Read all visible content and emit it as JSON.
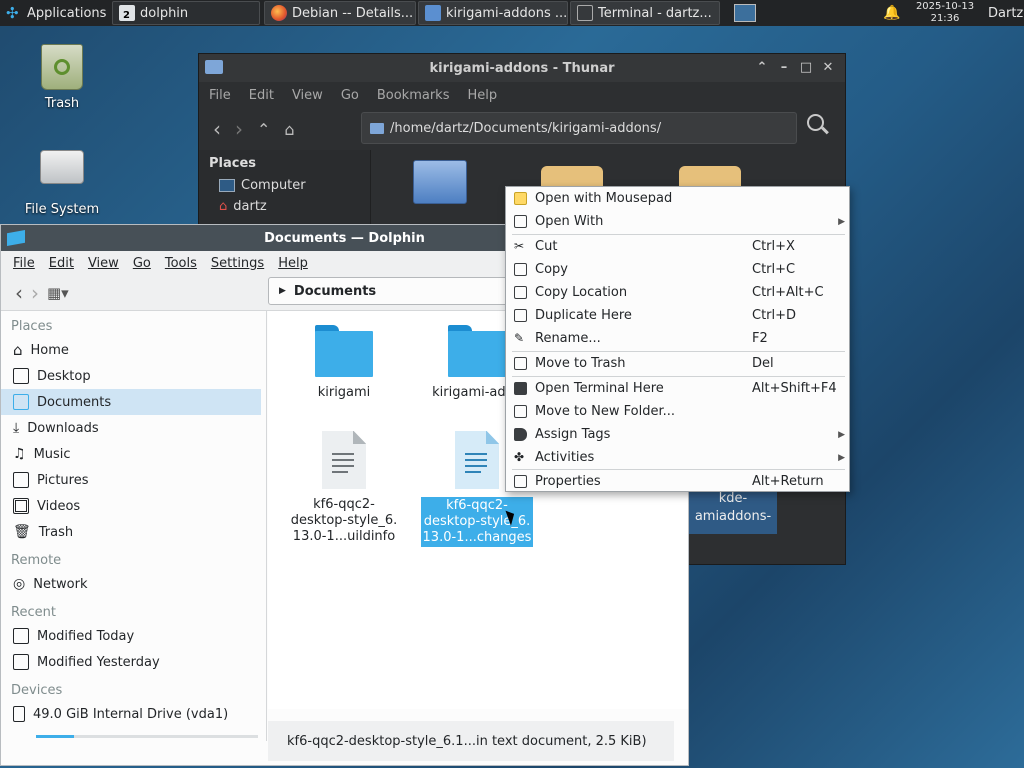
{
  "taskbar": {
    "applications_label": "Applications",
    "workspace_number": "2",
    "tasks": [
      {
        "label": "dolphin"
      },
      {
        "label": "Debian -- Details..."
      },
      {
        "label": "kirigami-addons ..."
      },
      {
        "label": "Terminal - dartz..."
      }
    ],
    "date": "2025-10-13",
    "time": "21:36",
    "user": "Dartz"
  },
  "desktop": {
    "trash_label": "Trash",
    "filesystem_label": "File System"
  },
  "thunar": {
    "title": "kirigami-addons - Thunar",
    "menu": [
      "File",
      "Edit",
      "View",
      "Go",
      "Bookmarks",
      "Help"
    ],
    "location": "/home/dartz/Documents/kirigami-addons/",
    "places_header": "Places",
    "places": [
      "Computer",
      "dartz"
    ],
    "partial_file": [
      "kde-",
      "amiaddons-"
    ]
  },
  "dolphin": {
    "title": "Documents — Dolphin",
    "menu": [
      "File",
      "Edit",
      "View",
      "Go",
      "Tools",
      "Settings",
      "Help"
    ],
    "breadcrumb": "Documents",
    "sidebar": {
      "places_header": "Places",
      "places": [
        "Home",
        "Desktop",
        "Documents",
        "Downloads",
        "Music",
        "Pictures",
        "Videos",
        "Trash"
      ],
      "remote_header": "Remote",
      "remote": [
        "Network"
      ],
      "recent_header": "Recent",
      "recent": [
        "Modified Today",
        "Modified Yesterday"
      ],
      "devices_header": "Devices",
      "devices": [
        "49.0 GiB Internal Drive (vda1)"
      ]
    },
    "files": [
      {
        "name": "kirigami",
        "type": "folder"
      },
      {
        "name": "kirigami-addo",
        "type": "folder"
      },
      {
        "name": "kf6-qqc2-\ndesktop-style_6.\n13.0-1...uildinfo",
        "type": "doc"
      },
      {
        "name": "kf6-qqc2-\ndesktop-style_6.\n13.0-1...changes",
        "type": "doc",
        "selected": true
      }
    ],
    "status": "kf6-qqc2-desktop-style_6.1...in text document, 2.5 KiB)"
  },
  "context_menu": {
    "items": [
      {
        "label": "Open with Mousepad",
        "shortcut": ""
      },
      {
        "label": "Open With",
        "shortcut": "",
        "submenu": true
      },
      {
        "label": "Cut",
        "shortcut": "Ctrl+X"
      },
      {
        "label": "Copy",
        "shortcut": "Ctrl+C"
      },
      {
        "label": "Copy Location",
        "shortcut": "Ctrl+Alt+C"
      },
      {
        "label": "Duplicate Here",
        "shortcut": "Ctrl+D"
      },
      {
        "label": "Rename...",
        "shortcut": "F2"
      },
      {
        "label": "Move to Trash",
        "shortcut": "Del"
      },
      {
        "label": "Open Terminal Here",
        "shortcut": "Alt+Shift+F4"
      },
      {
        "label": "Move to New Folder...",
        "shortcut": ""
      },
      {
        "label": "Assign Tags",
        "shortcut": "",
        "submenu": true
      },
      {
        "label": "Activities",
        "shortcut": "",
        "submenu": true
      },
      {
        "label": "Properties",
        "shortcut": "Alt+Return"
      }
    ]
  },
  "colors": {
    "accent": "#3daee9",
    "selection": "#3daee9",
    "sidebar_selection": "#cfe4f4"
  }
}
